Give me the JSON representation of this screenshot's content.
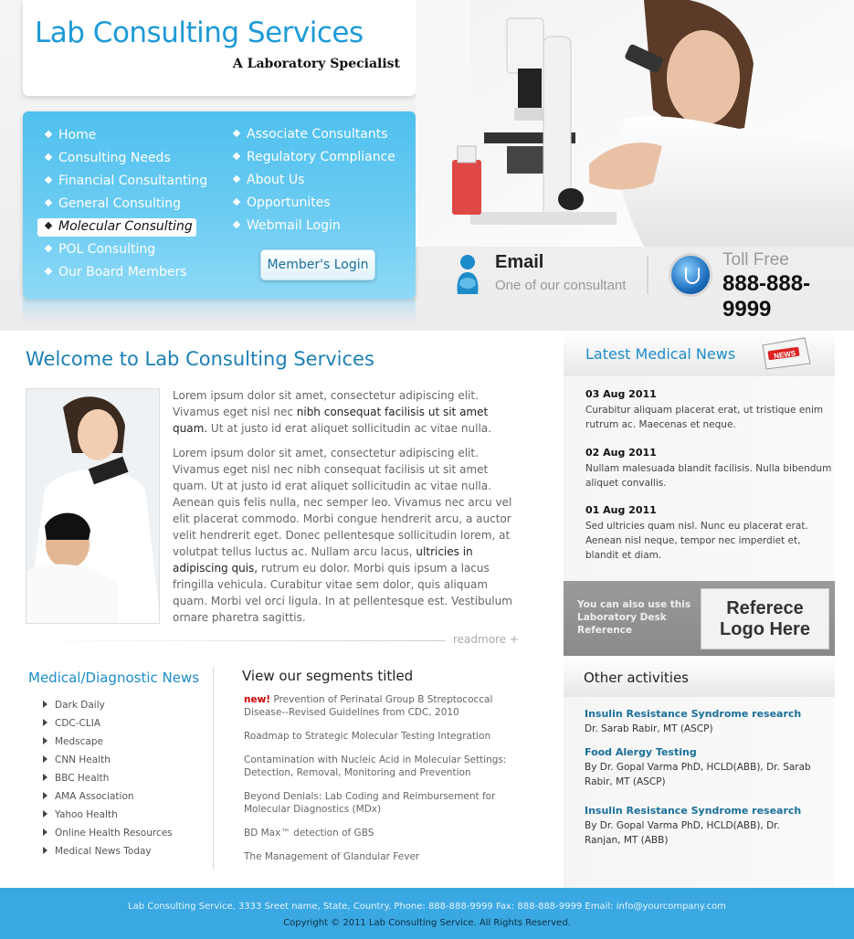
{
  "header": {
    "title": "Lab Consulting Services",
    "subtitle": "A Laboratory Specialist"
  },
  "nav": {
    "col1": [
      {
        "label": "Home"
      },
      {
        "label": "Consulting Needs"
      },
      {
        "label": "Financial Consultanting"
      },
      {
        "label": "General Consulting"
      },
      {
        "label": "Molecular Consulting"
      },
      {
        "label": "POL Consulting"
      },
      {
        "label": "Our Board Members"
      }
    ],
    "col2": [
      {
        "label": "Associate Consultants"
      },
      {
        "label": "Regulatory Compliance"
      },
      {
        "label": "About Us"
      },
      {
        "label": "Opportunites"
      },
      {
        "label": "Webmail Login"
      }
    ],
    "member_login": "Member's Login"
  },
  "contact": {
    "email_title": "Email",
    "email_sub": "One of our consultant",
    "toll_title": "Toll Free",
    "toll_number": "888-888-9999"
  },
  "welcome": {
    "title": "Welcome to  Lab Consulting Services",
    "p1_a": "Lorem ipsum dolor sit amet, consectetur adipiscing elit. Vivamus eget nisl nec ",
    "p1_hl": "nibh consequat facilisis ut sit amet quam.",
    "p1_b": " Ut at justo id erat aliquet sollicitudin ac vitae nulla.",
    "p2_a": "Lorem ipsum dolor sit amet, consectetur adipiscing elit. Vivamus eget nisl nec nibh consequat facilisis ut sit amet quam. Ut at justo id erat aliquet sollicitudin ac vitae nulla. Aenean quis felis nulla, nec semper leo. Vivamus nec arcu vel elit placerat commodo. Morbi congue hendrerit arcu, a auctor velit hendrerit eget. Donec pellentesque sollicitudin lorem, at volutpat tellus luctus ac. Nullam arcu lacus, ",
    "p2_hl": "ultricies in adipiscing quis,",
    "p2_b": " rutrum eu dolor. Morbi quis ipsum a lacus fringilla vehicula. Curabitur vitae sem dolor, quis aliquam quam. Morbi vel orci ligula. In at pellentesque est. Vestibulum ornare pharetra sagittis.",
    "readmore": "readmore +"
  },
  "medical": {
    "title": "Medical/Diagnostic News",
    "items": [
      "Dark Daily",
      "CDC-CLIA",
      "Medscape",
      "CNN Health",
      "BBC Health",
      "AMA Association",
      "Yahoo Health",
      "Online Health Resources",
      "Medical News Today"
    ]
  },
  "segments": {
    "title": "View our segments titled",
    "new_label": "new!",
    "items": [
      "Prevention of Perinatal Group B Streptococcal Disease--Revised Guidelines from CDC, 2010",
      "Roadmap to Strategic Molecular Testing Integration",
      "Contamination with Nucleic Acid in Molecular Settings: Detection, Removal, Monitoring and Prevention",
      "Beyond Denials: Lab Coding and Reimbursement for Molecular Diagnostics (MDx)",
      "BD Max™ detection of GBS",
      "The Management of Glandular Fever"
    ]
  },
  "latest_news": {
    "title": "Latest Medical News",
    "badge": "NEWS",
    "items": [
      {
        "date": "03 Aug 2011",
        "text": "Curabitur aliquam placerat erat, ut tristique enim rutrum ac. Maecenas et neque."
      },
      {
        "date": "02 Aug 2011",
        "text": "Nullam malesuada blandit facilisis. Nulla bibendum aliquet convallis."
      },
      {
        "date": "01 Aug 2011",
        "text": "Sed ultricies quam nisl. Nunc eu placerat erat. Aenean nisl neque, tempor nec imperdiet et, blandit et diam."
      }
    ]
  },
  "reference": {
    "text": "You can also use this Laboratory Desk Reference",
    "logo_line1": "Referece",
    "logo_line2": "Logo Here"
  },
  "activities": {
    "title": "Other activities",
    "items": [
      {
        "title": "Insulin Resistance Syndrome research",
        "by": "Dr. Sarab Rabir, MT (ASCP)"
      },
      {
        "title": "Food Alergy Testing",
        "by": "By Dr. Gopal Varma PhD, HCLD(ABB), Dr. Sarab Rabir, MT (ASCP)"
      },
      {
        "title": "Insulin Resistance Syndrome research",
        "by": "By Dr. Gopal Varma PhD, HCLD(ABB), Dr. Ranjan, MT (ABB)"
      }
    ]
  },
  "footer": {
    "line1": "Lab Consulting Service,   3333 Sreet name, State, Country.    Phone: 888-888-9999   Fax: 888-888-9999   Email: info@yourcompany.com",
    "line2": "Copyright © 2011  Lab Consulting Service. All Rights Reserved."
  },
  "colors": {
    "brand_blue": "#1e9ad6",
    "nav_blue": "#4fc0ee",
    "footer_blue": "#3aa8e2",
    "new_red": "#cc0000"
  }
}
